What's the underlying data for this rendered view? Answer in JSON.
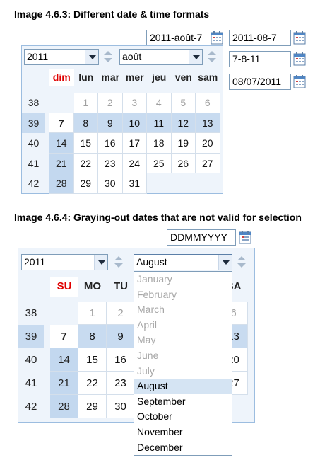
{
  "section1": {
    "caption": "Image 4.6.3: Different date & time formats",
    "inputs": [
      "2011-août-7",
      "2011-08-7",
      "7-8-11",
      "08/07/2011"
    ],
    "calendar": {
      "year": "2011",
      "month": "août",
      "headers": [
        "dim",
        "lun",
        "mar",
        "mer",
        "jeu",
        "ven",
        "sam"
      ],
      "weeks": [
        "38",
        "39",
        "40",
        "41",
        "42"
      ],
      "rows": [
        [
          "",
          "1",
          "2",
          "3",
          "4",
          "5",
          "6"
        ],
        [
          "7",
          "8",
          "9",
          "10",
          "11",
          "12",
          "13"
        ],
        [
          "14",
          "15",
          "16",
          "17",
          "18",
          "19",
          "20"
        ],
        [
          "21",
          "22",
          "23",
          "24",
          "25",
          "26",
          "27"
        ],
        [
          "28",
          "29",
          "30",
          "31",
          "",
          "",
          ""
        ]
      ]
    }
  },
  "section2": {
    "caption": "Image 4.6.4: Graying-out dates that are not valid for selection",
    "input": "DDMMYYYY",
    "calendar": {
      "year": "2011",
      "month": "August",
      "headers": [
        "SU",
        "MO",
        "TU",
        "",
        "",
        "",
        "SA"
      ],
      "weeks": [
        "38",
        "39",
        "40",
        "41",
        "42"
      ],
      "rows": [
        [
          "",
          "1",
          "2",
          "",
          "",
          "",
          "6"
        ],
        [
          "7",
          "8",
          "9",
          "",
          "",
          "",
          "13"
        ],
        [
          "14",
          "15",
          "16",
          "",
          "",
          "",
          "20"
        ],
        [
          "21",
          "22",
          "23",
          "",
          "",
          "",
          "27"
        ],
        [
          "28",
          "29",
          "30",
          "",
          "",
          "",
          ""
        ]
      ]
    },
    "month_options": [
      {
        "label": "January",
        "state": "disabled"
      },
      {
        "label": "February",
        "state": "disabled"
      },
      {
        "label": "March",
        "state": "disabled"
      },
      {
        "label": "April",
        "state": "disabled"
      },
      {
        "label": "May",
        "state": "disabled"
      },
      {
        "label": "June",
        "state": "disabled"
      },
      {
        "label": "July",
        "state": "disabled"
      },
      {
        "label": "August",
        "state": "selected"
      },
      {
        "label": "September",
        "state": "enabled"
      },
      {
        "label": "October",
        "state": "enabled"
      },
      {
        "label": "November",
        "state": "enabled"
      },
      {
        "label": "December",
        "state": "enabled"
      }
    ]
  },
  "icons": {
    "calendar_button": "calendar-icon",
    "dropdown_arrow": "chevron-down-icon",
    "spinner": "up-down-spinner-icon"
  },
  "colors": {
    "sunday_header": "#e00000",
    "calendar_bg": "#eef4fb",
    "selected_week": "#c8dbf0",
    "border": "#7f9db9"
  }
}
